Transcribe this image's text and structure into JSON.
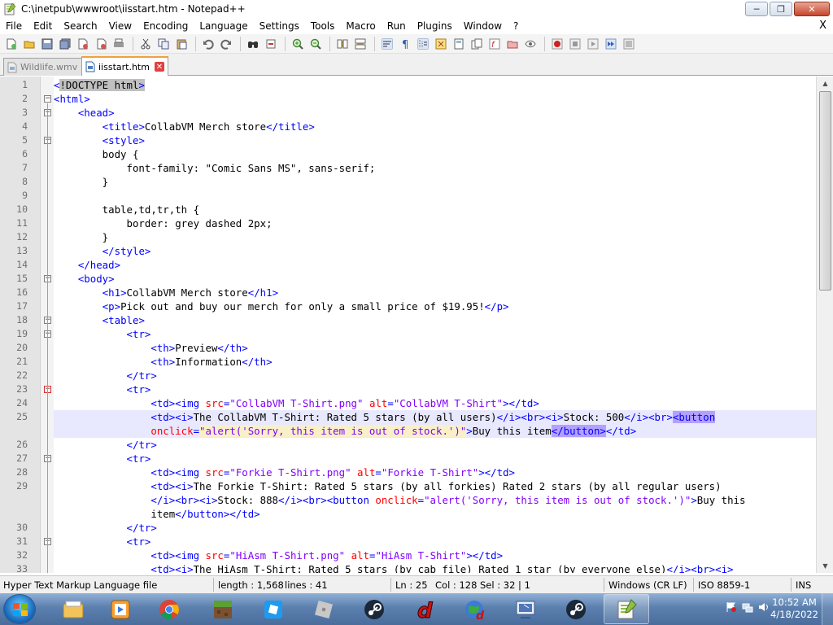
{
  "window": {
    "title": "C:\\inetpub\\wwwroot\\iisstart.htm - Notepad++",
    "minimize": "─",
    "maximize": "❐",
    "close": "✕"
  },
  "menu": {
    "items": [
      "File",
      "Edit",
      "Search",
      "View",
      "Encoding",
      "Language",
      "Settings",
      "Tools",
      "Macro",
      "Run",
      "Plugins",
      "Window",
      "?"
    ],
    "close_label": "X"
  },
  "tabs": [
    {
      "label": "Wildlife.wmv",
      "active": false
    },
    {
      "label": "iisstart.htm",
      "active": true
    }
  ],
  "editor": {
    "lines": [
      {
        "n": "1",
        "rows": [
          [
            [
              "t-tag",
              "<"
            ],
            [
              "t-doc sel-bg",
              "!DOCTYPE html"
            ],
            [
              "t-tag sel-bg",
              ">"
            ]
          ]
        ]
      },
      {
        "n": "2",
        "rows": [
          [
            [
              "t-tag",
              "<html>"
            ]
          ]
        ]
      },
      {
        "n": "3",
        "rows": [
          [
            [
              "t-text",
              "    "
            ],
            [
              "t-tag",
              "<head>"
            ]
          ]
        ]
      },
      {
        "n": "4",
        "rows": [
          [
            [
              "t-text",
              "        "
            ],
            [
              "t-tag",
              "<title>"
            ],
            [
              "t-text",
              "CollabVM Merch store"
            ],
            [
              "t-tag",
              "</title>"
            ]
          ]
        ]
      },
      {
        "n": "5",
        "rows": [
          [
            [
              "t-text",
              "        "
            ],
            [
              "t-tag",
              "<style>"
            ]
          ]
        ]
      },
      {
        "n": "6",
        "rows": [
          [
            [
              "t-css",
              "        body {"
            ]
          ]
        ]
      },
      {
        "n": "7",
        "rows": [
          [
            [
              "t-css",
              "            font-family: \"Comic Sans MS\", sans-serif;"
            ]
          ]
        ]
      },
      {
        "n": "8",
        "rows": [
          [
            [
              "t-css",
              "        }"
            ]
          ]
        ]
      },
      {
        "n": "9",
        "rows": [
          [
            [
              "t-css",
              ""
            ]
          ]
        ]
      },
      {
        "n": "10",
        "rows": [
          [
            [
              "t-css",
              "        table,td,tr,th {"
            ]
          ]
        ]
      },
      {
        "n": "11",
        "rows": [
          [
            [
              "t-css",
              "            border: grey dashed 2px;"
            ]
          ]
        ]
      },
      {
        "n": "12",
        "rows": [
          [
            [
              "t-css",
              "        }"
            ]
          ]
        ]
      },
      {
        "n": "13",
        "rows": [
          [
            [
              "t-text",
              "        "
            ],
            [
              "t-tag",
              "</style>"
            ]
          ]
        ]
      },
      {
        "n": "14",
        "rows": [
          [
            [
              "t-text",
              "    "
            ],
            [
              "t-tag",
              "</head>"
            ]
          ]
        ]
      },
      {
        "n": "15",
        "rows": [
          [
            [
              "t-text",
              "    "
            ],
            [
              "t-tag",
              "<body>"
            ]
          ]
        ]
      },
      {
        "n": "16",
        "rows": [
          [
            [
              "t-text",
              "        "
            ],
            [
              "t-tag",
              "<h1>"
            ],
            [
              "t-text",
              "CollabVM Merch store"
            ],
            [
              "t-tag",
              "</h1>"
            ]
          ]
        ]
      },
      {
        "n": "17",
        "rows": [
          [
            [
              "t-text",
              "        "
            ],
            [
              "t-tag",
              "<p>"
            ],
            [
              "t-text",
              "Pick out and buy our merch for only a small price of $19.95!"
            ],
            [
              "t-tag",
              "</p>"
            ]
          ]
        ]
      },
      {
        "n": "18",
        "rows": [
          [
            [
              "t-text",
              "        "
            ],
            [
              "t-tag",
              "<table>"
            ]
          ]
        ]
      },
      {
        "n": "19",
        "rows": [
          [
            [
              "t-text",
              "            "
            ],
            [
              "t-tag",
              "<tr>"
            ]
          ]
        ]
      },
      {
        "n": "20",
        "rows": [
          [
            [
              "t-text",
              "                "
            ],
            [
              "t-tag",
              "<th>"
            ],
            [
              "t-text",
              "Preview"
            ],
            [
              "t-tag",
              "</th>"
            ]
          ]
        ]
      },
      {
        "n": "21",
        "rows": [
          [
            [
              "t-text",
              "                "
            ],
            [
              "t-tag",
              "<th>"
            ],
            [
              "t-text",
              "Information"
            ],
            [
              "t-tag",
              "</th>"
            ]
          ]
        ]
      },
      {
        "n": "22",
        "rows": [
          [
            [
              "t-text",
              "            "
            ],
            [
              "t-tag",
              "</tr>"
            ]
          ]
        ]
      },
      {
        "n": "23",
        "rows": [
          [
            [
              "t-text",
              "            "
            ],
            [
              "t-tag",
              "<tr>"
            ]
          ]
        ]
      },
      {
        "n": "24",
        "rows": [
          [
            [
              "t-text",
              "                "
            ],
            [
              "t-tag",
              "<td><img "
            ],
            [
              "t-attr",
              "src"
            ],
            [
              "t-tag",
              "="
            ],
            [
              "t-str",
              "\"CollabVM T-Shirt.png\""
            ],
            [
              "t-tag",
              " "
            ],
            [
              "t-attr",
              "alt"
            ],
            [
              "t-tag",
              "="
            ],
            [
              "t-str",
              "\"CollabVM T-Shirt\""
            ],
            [
              "t-tag",
              "></td>"
            ]
          ]
        ]
      },
      {
        "n": "25",
        "rows": [
          [
            [
              "t-text",
              "                "
            ],
            [
              "t-tag",
              "<td><i>"
            ],
            [
              "t-text",
              "The CollabVM T-Shirt: Rated 5 stars (by all users)"
            ],
            [
              "t-tag",
              "</i><br><i>"
            ],
            [
              "t-text",
              "Stock: 500"
            ],
            [
              "t-tag",
              "</i><br>"
            ],
            [
              "t-tag match-bg",
              "<button"
            ]
          ],
          [
            [
              "t-text",
              "                "
            ],
            [
              "t-attr",
              "onclick"
            ],
            [
              "t-tag",
              "="
            ],
            [
              "t-str str-hl",
              "\"alert('Sorry, this item is out of stock.')\""
            ],
            [
              "t-tag",
              ">"
            ],
            [
              "t-text",
              "Buy this item"
            ],
            [
              "t-tag match-bg",
              "</button>"
            ],
            [
              "t-tag",
              "</td>"
            ]
          ]
        ]
      },
      {
        "n": "26",
        "rows": [
          [
            [
              "t-text",
              "            "
            ],
            [
              "t-tag",
              "</tr>"
            ]
          ]
        ]
      },
      {
        "n": "27",
        "rows": [
          [
            [
              "t-text",
              "            "
            ],
            [
              "t-tag",
              "<tr>"
            ]
          ]
        ]
      },
      {
        "n": "28",
        "rows": [
          [
            [
              "t-text",
              "                "
            ],
            [
              "t-tag",
              "<td><img "
            ],
            [
              "t-attr",
              "src"
            ],
            [
              "t-tag",
              "="
            ],
            [
              "t-str",
              "\"Forkie T-Shirt.png\""
            ],
            [
              "t-tag",
              " "
            ],
            [
              "t-attr",
              "alt"
            ],
            [
              "t-tag",
              "="
            ],
            [
              "t-str",
              "\"Forkie T-Shirt\""
            ],
            [
              "t-tag",
              "></td>"
            ]
          ]
        ]
      },
      {
        "n": "29",
        "rows": [
          [
            [
              "t-text",
              "                "
            ],
            [
              "t-tag",
              "<td><i>"
            ],
            [
              "t-text",
              "The Forkie T-Shirt: Rated 5 stars (by all forkies) Rated 2 stars (by all regular users)"
            ]
          ],
          [
            [
              "t-text",
              "                "
            ],
            [
              "t-tag",
              "</i><br><i>"
            ],
            [
              "t-text",
              "Stock: 888"
            ],
            [
              "t-tag",
              "</i><br><button "
            ],
            [
              "t-attr",
              "onclick"
            ],
            [
              "t-tag",
              "="
            ],
            [
              "t-str",
              "\"alert('Sorry, this item is out of stock.')\""
            ],
            [
              "t-tag",
              ">"
            ],
            [
              "t-text",
              "Buy this"
            ]
          ],
          [
            [
              "t-text",
              "                item"
            ],
            [
              "t-tag",
              "</button></td>"
            ]
          ]
        ]
      },
      {
        "n": "30",
        "rows": [
          [
            [
              "t-text",
              "            "
            ],
            [
              "t-tag",
              "</tr>"
            ]
          ]
        ]
      },
      {
        "n": "31",
        "rows": [
          [
            [
              "t-text",
              "            "
            ],
            [
              "t-tag",
              "<tr>"
            ]
          ]
        ]
      },
      {
        "n": "32",
        "rows": [
          [
            [
              "t-text",
              "                "
            ],
            [
              "t-tag",
              "<td><img "
            ],
            [
              "t-attr",
              "src"
            ],
            [
              "t-tag",
              "="
            ],
            [
              "t-str",
              "\"HiAsm T-Shirt.png\""
            ],
            [
              "t-tag",
              " "
            ],
            [
              "t-attr",
              "alt"
            ],
            [
              "t-tag",
              "="
            ],
            [
              "t-str",
              "\"HiAsm T-Shirt\""
            ],
            [
              "t-tag",
              "></td>"
            ]
          ]
        ]
      },
      {
        "n": "33",
        "rows": [
          [
            [
              "t-text",
              "                "
            ],
            [
              "t-tag",
              "<td><i>"
            ],
            [
              "t-text",
              "The HiAsm T-Shirt: Rated 5 stars (by cab file) Rated 1 star (by everyone else)"
            ],
            [
              "t-tag",
              "</i><br><i>"
            ]
          ]
        ]
      }
    ]
  },
  "status": {
    "file_type": "Hyper Text Markup Language file",
    "length": "length : 1,568",
    "lines": "lines : 41",
    "ln": "Ln : 25",
    "col": "Col : 128",
    "sel": "Sel : 32 | 1",
    "eol": "Windows (CR LF)",
    "encoding": "ISO 8859-1",
    "mode": "INS"
  },
  "taskbar": {
    "apps": [
      "explorer-icon",
      "media-player-icon",
      "chrome-icon",
      "minecraft-icon",
      "roblox-studio-icon",
      "roblox-icon",
      "steam-icon",
      "dolphin-icon",
      "worldpainter-icon",
      "virtualbox-icon",
      "steam-icon",
      "notepadpp-icon"
    ],
    "time": "10:52 AM",
    "date": "4/18/2022"
  }
}
